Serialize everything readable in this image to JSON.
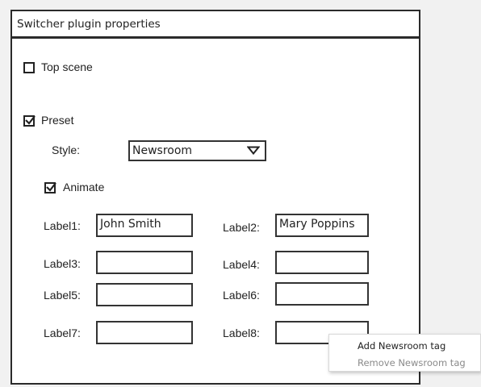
{
  "dialog": {
    "title": "Switcher plugin properties",
    "top_scene": {
      "label": "Top scene",
      "checked": false
    },
    "preset": {
      "label": "Preset",
      "checked": true
    },
    "style": {
      "label": "Style:",
      "value": "Newsroom"
    },
    "animate": {
      "label": "Animate",
      "checked": true
    },
    "labels": [
      {
        "label": "Label1:",
        "value": "John Smith"
      },
      {
        "label": "Label2:",
        "value": "Mary Poppins"
      },
      {
        "label": "Label3:",
        "value": ""
      },
      {
        "label": "Label4:",
        "value": ""
      },
      {
        "label": "Label5:",
        "value": ""
      },
      {
        "label": "Label6:",
        "value": ""
      },
      {
        "label": "Label7:",
        "value": ""
      },
      {
        "label": "Label8:",
        "value": ""
      }
    ]
  },
  "context_menu": {
    "items": [
      {
        "label": "Add Newsroom tag",
        "enabled": true
      },
      {
        "label": "Remove Newsroom tag",
        "enabled": false
      }
    ],
    "enabled_color": "#222222",
    "disabled_color": "#8a8a8a"
  },
  "icons": {
    "checkbox": "checkbox-icon",
    "checkmark": "checkmark-icon",
    "dropdown": "triangle-down-icon"
  }
}
